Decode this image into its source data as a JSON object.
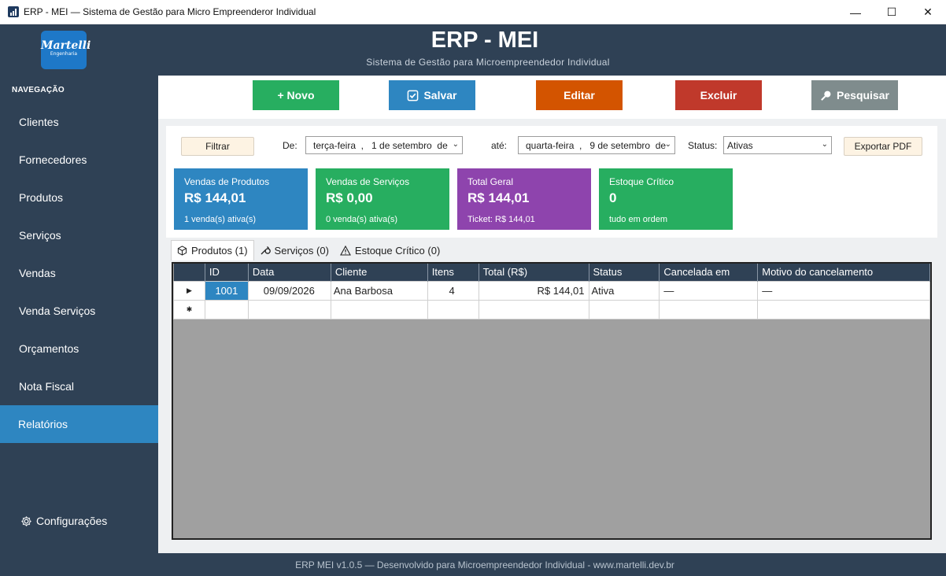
{
  "window": {
    "title": "ERP - MEI — Sistema de Gestão para Micro Empreenderor Individual",
    "minimize": "—",
    "maximize": "☐",
    "close": "✕"
  },
  "header": {
    "logo_text": "Martelli",
    "logo_sub": "Engenharia",
    "title": "ERP - MEI",
    "subtitle": "Sistema de Gestão para Microempreendedor Individual"
  },
  "sidebar": {
    "heading": "NAVEGAÇÃO",
    "items": [
      {
        "label": "Clientes"
      },
      {
        "label": "Fornecedores"
      },
      {
        "label": "Produtos"
      },
      {
        "label": "Serviços"
      },
      {
        "label": "Vendas"
      },
      {
        "label": "Venda Serviços"
      },
      {
        "label": "Orçamentos"
      },
      {
        "label": "Nota Fiscal"
      },
      {
        "label": "Relatórios",
        "active": true
      }
    ],
    "settings": "Configurações"
  },
  "toolbar": {
    "novo": "+ Novo",
    "salvar": "Salvar",
    "editar": "Editar",
    "excluir": "Excluir",
    "pesquisar": "Pesquisar",
    "colors": {
      "novo": "#27ae60",
      "salvar": "#2e86c1",
      "editar": "#d35400",
      "excluir": "#c0392b",
      "pesquisar": "#7f8c8d"
    }
  },
  "filters": {
    "filtrar": "Filtrar",
    "de_label": "De:",
    "de_value": "terça-feira  ,   1 de setembro  de",
    "ate_label": "até:",
    "ate_value": "quarta-feira  ,   9 de setembro  de",
    "status_label": "Status:",
    "status_value": "Ativas",
    "export": "Exportar PDF"
  },
  "cards": [
    {
      "title": "Vendas de Produtos",
      "value": "R$ 144,01",
      "sub": "1 venda(s) ativa(s)",
      "color": "#2e86c1"
    },
    {
      "title": "Vendas de Serviços",
      "value": "R$ 0,00",
      "sub": "0 venda(s) ativa(s)",
      "color": "#27ae60"
    },
    {
      "title": "Total Geral",
      "value": "R$ 144,01",
      "sub": "Ticket: R$ 144,01",
      "color": "#8e44ad"
    },
    {
      "title": "Estoque Crítico",
      "value": "0",
      "sub": "tudo em ordem",
      "color": "#27ae60"
    }
  ],
  "tabs": [
    {
      "label": "Produtos (1)",
      "icon": "box-icon"
    },
    {
      "label": "Serviços (0)",
      "icon": "wrench-icon"
    },
    {
      "label": "Estoque Crítico (0)",
      "icon": "warning-icon"
    }
  ],
  "table": {
    "columns": [
      "ID",
      "Data",
      "Cliente",
      "Itens",
      "Total (R$)",
      "Status",
      "Cancelada em",
      "Motivo do cancelamento"
    ],
    "rows": [
      [
        "1001",
        "09/09/2026",
        "Ana Barbosa",
        "4",
        "R$ 144,01",
        "Ativa",
        "—",
        "—"
      ]
    ]
  },
  "footer": "ERP MEI v1.0.5  —  Desenvolvido para Microempreendedor Individual  -  www.martelli.dev.br"
}
